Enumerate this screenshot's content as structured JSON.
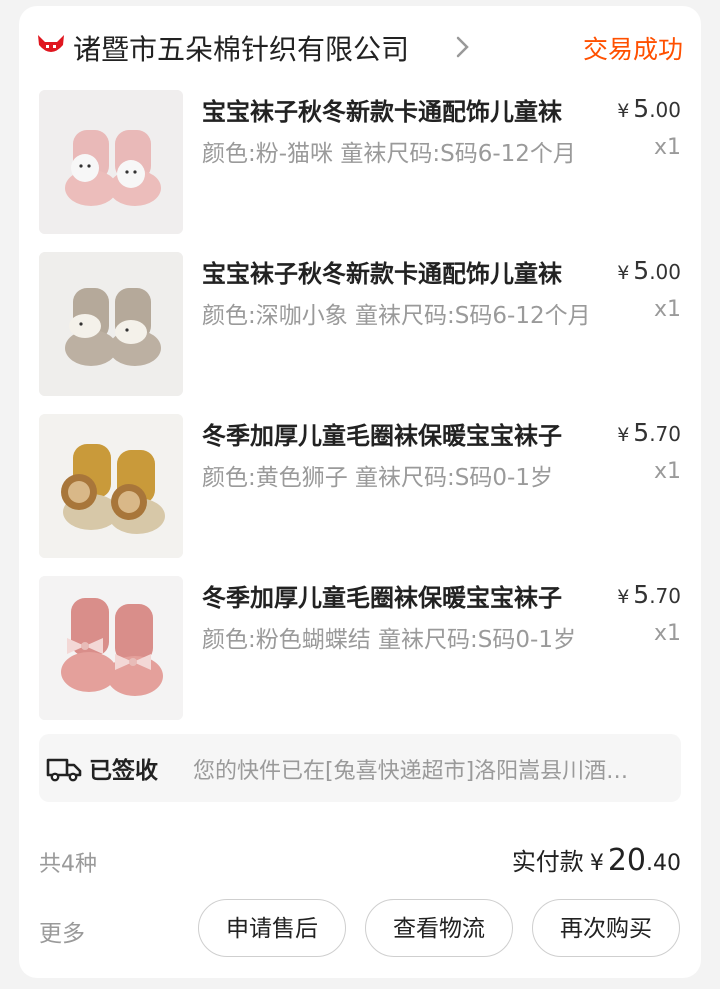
{
  "shop": {
    "name": "诸暨市五朵棉针织有限公司",
    "logo_icon": "tmall-cat-icon",
    "status": "交易成功"
  },
  "items": [
    {
      "title": "宝宝袜子秋冬新款卡通配饰儿童袜",
      "spec": "颜色:粉-猫咪  童袜尺码:S码6-12个月",
      "currency": "¥",
      "price_int": "5",
      "price_dec": ".00",
      "qty": "x1"
    },
    {
      "title": "宝宝袜子秋冬新款卡通配饰儿童袜",
      "spec": "颜色:深咖小象  童袜尺码:S码6-12个月",
      "currency": "¥",
      "price_int": "5",
      "price_dec": ".00",
      "qty": "x1"
    },
    {
      "title": "冬季加厚儿童毛圈袜保暖宝宝袜子",
      "spec": "颜色:黄色狮子  童袜尺码:S码0-1岁",
      "currency": "¥",
      "price_int": "5",
      "price_dec": ".70",
      "qty": "x1"
    },
    {
      "title": "冬季加厚儿童毛圈袜保暖宝宝袜子",
      "spec": "颜色:粉色蝴蝶结  童袜尺码:S码0-1岁",
      "currency": "¥",
      "price_int": "5",
      "price_dec": ".70",
      "qty": "x1"
    }
  ],
  "logistics": {
    "status": "已签收",
    "detail": "您的快件已在[兔喜快递超市]洛阳嵩县川酒…",
    "icon": "truck-icon"
  },
  "summary": {
    "count": "共4种",
    "paid_label": "实付款",
    "currency": "¥",
    "total_int": "20",
    "total_dec": ".40"
  },
  "actions": {
    "more": "更多",
    "after_sale": "申请售后",
    "view_logistics": "查看物流",
    "buy_again": "再次购买"
  },
  "colors": {
    "accent": "#ff5000",
    "muted": "#9a9a9a",
    "text": "#222222"
  }
}
